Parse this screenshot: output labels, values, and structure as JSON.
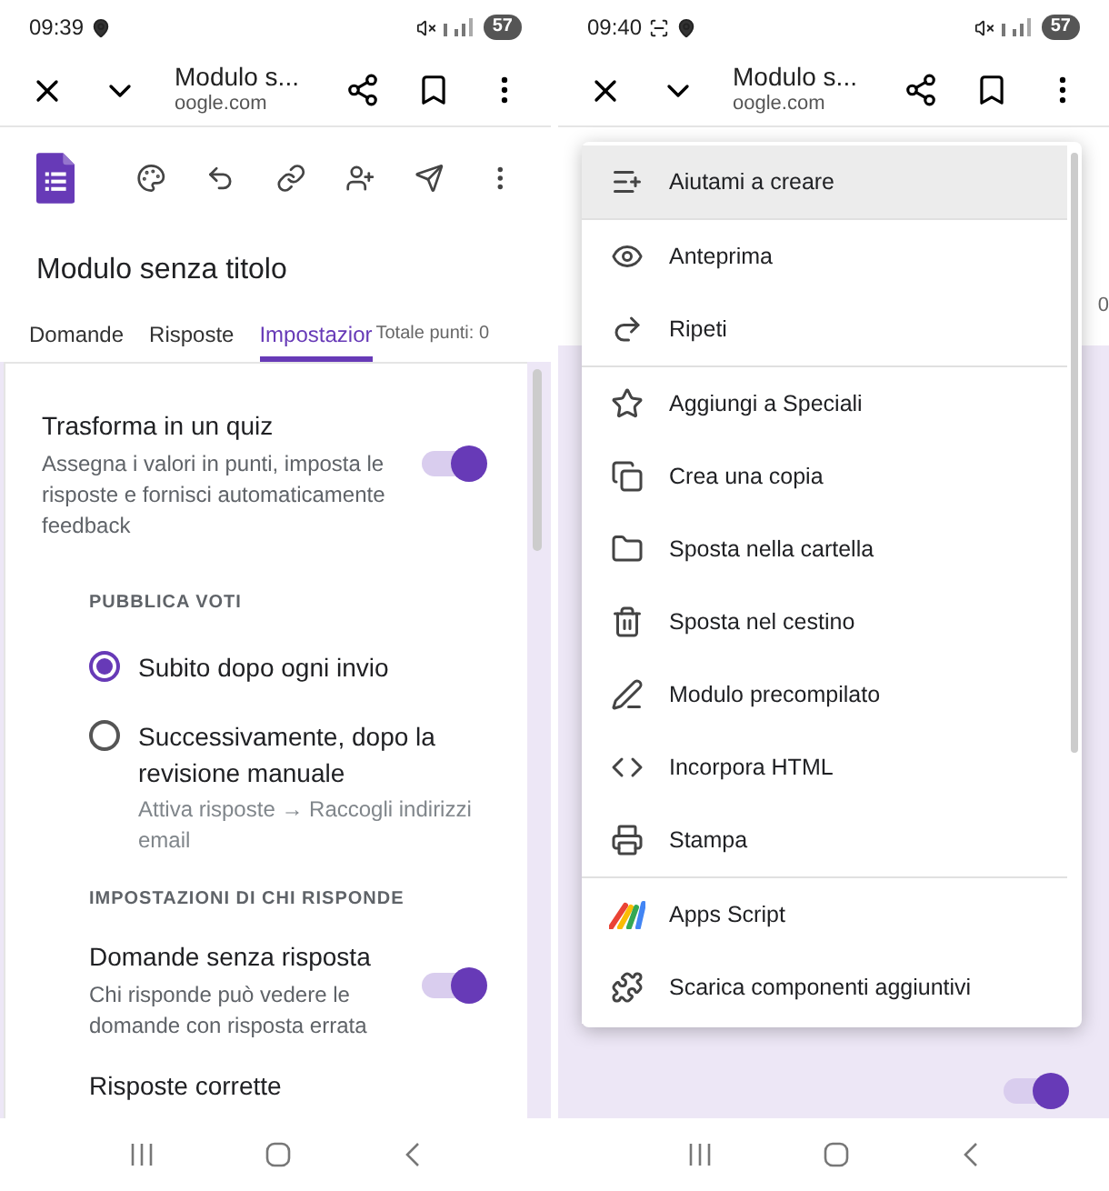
{
  "left_screen": {
    "status_bar": {
      "time": "09:39",
      "battery": "57"
    },
    "browser_bar": {
      "title": "Modulo s...",
      "url": "oogle.com"
    },
    "form_title": "Modulo senza titolo",
    "tabs": [
      {
        "label": "Domande",
        "selected": false
      },
      {
        "label": "Risposte",
        "selected": false
      },
      {
        "label": "Impostazior",
        "selected": true
      }
    ],
    "total_points": "Totale punti: 0",
    "quiz_setting": {
      "title": "Trasforma in un quiz",
      "description": "Assegna i valori in punti, imposta le risposte e fornisci automaticamente feedback",
      "on": true
    },
    "publish_section": "PUBBLICA VOTI",
    "publish_options": [
      {
        "label": "Subito dopo ogni invio",
        "selected": true
      },
      {
        "label": "Successivamente, dopo la revisione manuale",
        "hint": "Attiva risposte → Raccogli indirizzi email",
        "selected": false
      }
    ],
    "respondent_section": "IMPOSTAZIONI DI CHI RISPONDE",
    "respondent_settings": [
      {
        "title": "Domande senza risposta",
        "description": "Chi risponde può vedere le domande con risposta errata",
        "on": true
      },
      {
        "title": "Risposte corrette"
      }
    ]
  },
  "right_screen": {
    "status_bar": {
      "time": "09:40",
      "battery": "57"
    },
    "browser_bar": {
      "title": "Modulo s...",
      "url": "oogle.com"
    },
    "background_total": "0",
    "background_toggle_on": true,
    "menu": {
      "groups": [
        [
          {
            "label": "Aiutami a creare",
            "highlighted": true
          }
        ],
        [
          {
            "label": "Anteprima",
            "highlighted": false
          },
          {
            "label": "Ripeti",
            "highlighted": false
          }
        ],
        [
          {
            "label": "Aggiungi a Speciali",
            "highlighted": false
          },
          {
            "label": "Crea una copia",
            "highlighted": false
          },
          {
            "label": "Sposta nella cartella",
            "highlighted": false
          },
          {
            "label": "Sposta nel cestino",
            "highlighted": false
          },
          {
            "label": "Modulo precompilato",
            "highlighted": false
          },
          {
            "label": "Incorpora HTML",
            "highlighted": false
          },
          {
            "label": "Stampa",
            "highlighted": false
          }
        ],
        [
          {
            "label": "Apps Script",
            "highlighted": false
          },
          {
            "label": "Scarica componenti aggiuntivi",
            "highlighted": false
          }
        ]
      ]
    }
  }
}
